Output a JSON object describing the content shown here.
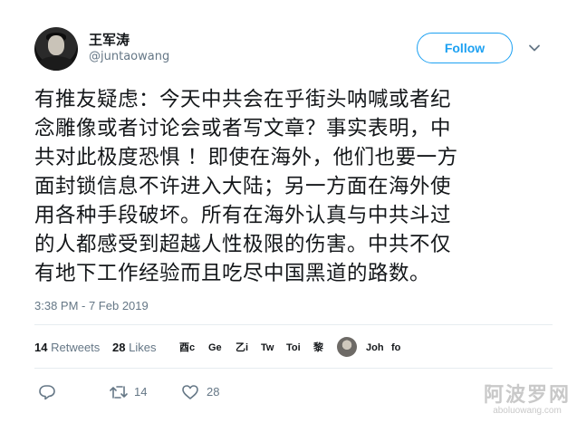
{
  "author": {
    "display_name": "王军涛",
    "handle": "@juntaowang",
    "avatar_icon": "profile-photo"
  },
  "follow_label": "Follow",
  "tweet_lines": [
    "有推友疑虑：今天中共会在乎街头呐喊或者纪",
    "念雕像或者讨论会或者写文章？事实表明，中",
    "共对此极度恐惧 ！即使在海外，他们也要一方",
    "面封锁信息不许进入大陆；另一方面在海外使",
    "用各种手段破坏。所有在海外认真与中共斗过",
    "的人都感受到超越人性极限的伤害。中共不仅",
    "有地下工作经验而且吃尽中国黑道的路数。"
  ],
  "timestamp": "3:38 PM - 7 Feb 2019",
  "stats": {
    "retweets_count": "14",
    "retweets_label": "Retweets",
    "likes_count": "28",
    "likes_label": "Likes"
  },
  "likers": [
    "酉c",
    "Ge",
    "乙i",
    "Tw",
    "Toi",
    "黎",
    "Joh",
    "fo"
  ],
  "actions": {
    "reply_icon": "reply-icon",
    "retweet_icon": "retweet-icon",
    "retweet_count": "14",
    "like_icon": "heart-icon",
    "like_count": "28"
  },
  "watermark": {
    "title": "阿波罗网",
    "url": "aboluowang.com"
  },
  "colors": {
    "accent": "#1da1f2",
    "text": "#14171a",
    "muted": "#657786",
    "divider": "#e6ecf0"
  }
}
